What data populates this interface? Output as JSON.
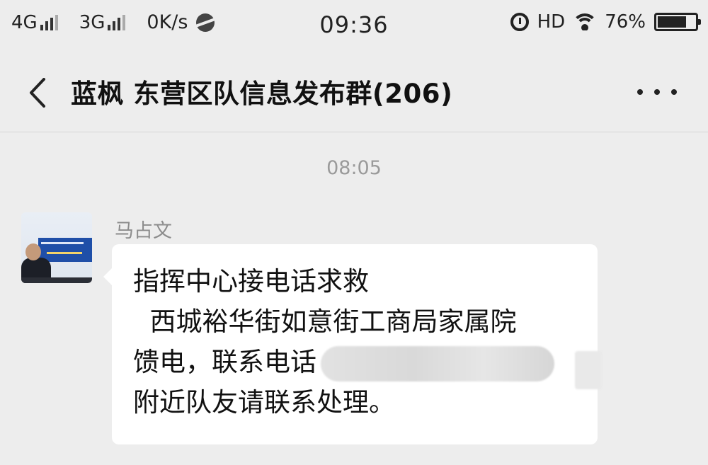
{
  "status_bar": {
    "net1": "4G",
    "net2": "3G",
    "speed": "0K/s",
    "time": "09:36",
    "hd": "HD",
    "battery": "76%",
    "battery_level": 0.76
  },
  "header": {
    "title": "蓝枫 东营区队信息发布群(206)"
  },
  "chat": {
    "timestamp": "08:05",
    "messages": [
      {
        "sender": "马占文",
        "lines": [
          "指挥中心接电话求救",
          "  西城裕华街如意街工商局家属院",
          "馈电，联系电话",
          "附近队友请联系处理。"
        ]
      }
    ]
  },
  "colors": {
    "background": "#ededed",
    "bubble": "#ffffff",
    "meta_text": "#9a9a9a"
  }
}
